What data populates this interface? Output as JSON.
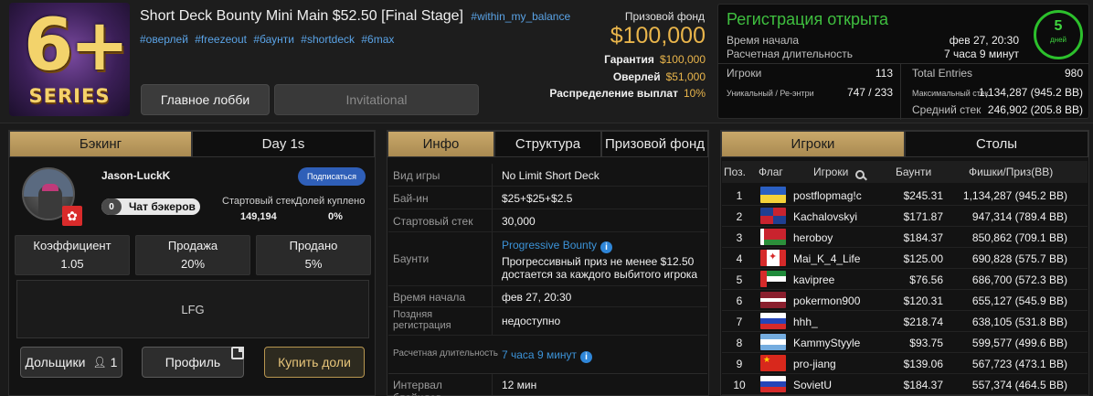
{
  "header": {
    "title": "Short Deck Bounty Mini Main $52.50 [Final Stage]",
    "title_tag": "#within_my_balance",
    "tags": [
      "#оверлей",
      "#freezeout",
      "#баунти",
      "#shortdeck",
      "#6max"
    ],
    "logo_text": "6+",
    "logo_sub": "SERIES",
    "btn_lobby": "Главное лобби",
    "btn_invitational": "Invitational"
  },
  "prize": {
    "label": "Призовой фонд",
    "value": "$100,000",
    "guarantee_label": "Гарантия",
    "guarantee_value": "$100,000",
    "overlay_label": "Оверлей",
    "overlay_value": "$51,000",
    "payout_label": "Распределение выплат",
    "payout_value": "10%"
  },
  "registration": {
    "title": "Регистрация открыта",
    "start_label": "Время начала",
    "start_value": "фев 27, 20:30",
    "duration_label": "Расчетная длительность",
    "duration_value": "7 часа 9 минут",
    "days_number": "5",
    "days_label": "дней",
    "players_label": "Игроки",
    "players_value": "113",
    "unique_label": "Уникальный / Ре-энтри",
    "unique_value": "747 / 233",
    "entries_label": "Total Entries",
    "entries_value": "980",
    "max_stack_label": "Максимальный стек",
    "max_stack_value": "1,134,287 (945.2 BB)",
    "avg_stack_label": "Средний стек",
    "avg_stack_value": "246,902 (205.8 BB)"
  },
  "backing": {
    "tabs": [
      "Бэкинг",
      "Day 1s"
    ],
    "name": "Jason-LuckK",
    "subscribe": "Подписаться",
    "backers_count": "0",
    "backers_chat": "Чат бэкеров",
    "start_stack_label": "Стартовый стек",
    "start_stack_value": "149,194",
    "shares_label": "Долей куплено",
    "shares_value": "0%",
    "coef_label": "Коэффициент",
    "coef_value": "1.05",
    "sale_label": "Продажа",
    "sale_value": "20%",
    "sold_label": "Продано",
    "sold_value": "5%",
    "message": "LFG",
    "stakeholders": "Дольщики",
    "stakeholders_count": "1",
    "profile": "Профиль",
    "buy_shares": "Купить доли"
  },
  "info": {
    "tabs": [
      "Инфо",
      "Структура",
      "Призовой фонд"
    ],
    "rows": [
      {
        "k": "Вид игры",
        "v": "No Limit Short Deck"
      },
      {
        "k": "Бай-ин",
        "v": "$25+$25+$2.5"
      },
      {
        "k": "Стартовый стек",
        "v": "30,000"
      },
      {
        "k": "Баунти",
        "v_title": "Progressive Bounty",
        "v": "Прогрессивный приз не менее $12.50",
        "v2": "достается за каждого выбитого игрока"
      },
      {
        "k": "Время начала",
        "v": "фев 27, 20:30"
      },
      {
        "k": "Поздняя регистрация",
        "v": "недоступно"
      },
      {
        "k": "Расчетная длительность",
        "v": "7 часа 9 минут"
      },
      {
        "k": "Интервал блайндов",
        "v": "12 мин"
      }
    ]
  },
  "players": {
    "tabs": [
      "Игроки",
      "Столы"
    ],
    "headers": {
      "pos": "Поз.",
      "flag": "Флаг",
      "name": "Игроки",
      "bounty": "Баунти",
      "chips": "Фишки/Приз(BB)"
    },
    "rows": [
      {
        "pos": "1",
        "name": "postflopmag!c",
        "bounty": "$245.31",
        "chips": "1,134,287 (945.2 BB)",
        "flag": "ukraine"
      },
      {
        "pos": "2",
        "name": "Kachalovskyi",
        "bounty": "$171.87",
        "chips": "947,314 (789.4 BB)",
        "flag": "dominican"
      },
      {
        "pos": "3",
        "name": "heroboy",
        "bounty": "$184.37",
        "chips": "850,862 (709.1 BB)",
        "flag": "belarus"
      },
      {
        "pos": "4",
        "name": "Mai_K_4_Life",
        "bounty": "$125.00",
        "chips": "690,828 (575.7 BB)",
        "flag": "canada"
      },
      {
        "pos": "5",
        "name": "kavipree",
        "bounty": "$76.56",
        "chips": "686,700 (572.3 BB)",
        "flag": "uae"
      },
      {
        "pos": "6",
        "name": "pokermon900",
        "bounty": "$120.31",
        "chips": "655,127 (545.9 BB)",
        "flag": "latvia"
      },
      {
        "pos": "7",
        "name": "hhh_",
        "bounty": "$218.74",
        "chips": "638,105 (531.8 BB)",
        "flag": "russia"
      },
      {
        "pos": "8",
        "name": "KammyStyyle",
        "bounty": "$93.75",
        "chips": "599,577 (499.6 BB)",
        "flag": "argentina"
      },
      {
        "pos": "9",
        "name": "pro-jiang",
        "bounty": "$139.06",
        "chips": "567,723 (473.1 BB)",
        "flag": "china"
      },
      {
        "pos": "10",
        "name": "SovietU",
        "bounty": "$184.37",
        "chips": "557,374 (464.5 BB)",
        "flag": "russia"
      }
    ]
  }
}
